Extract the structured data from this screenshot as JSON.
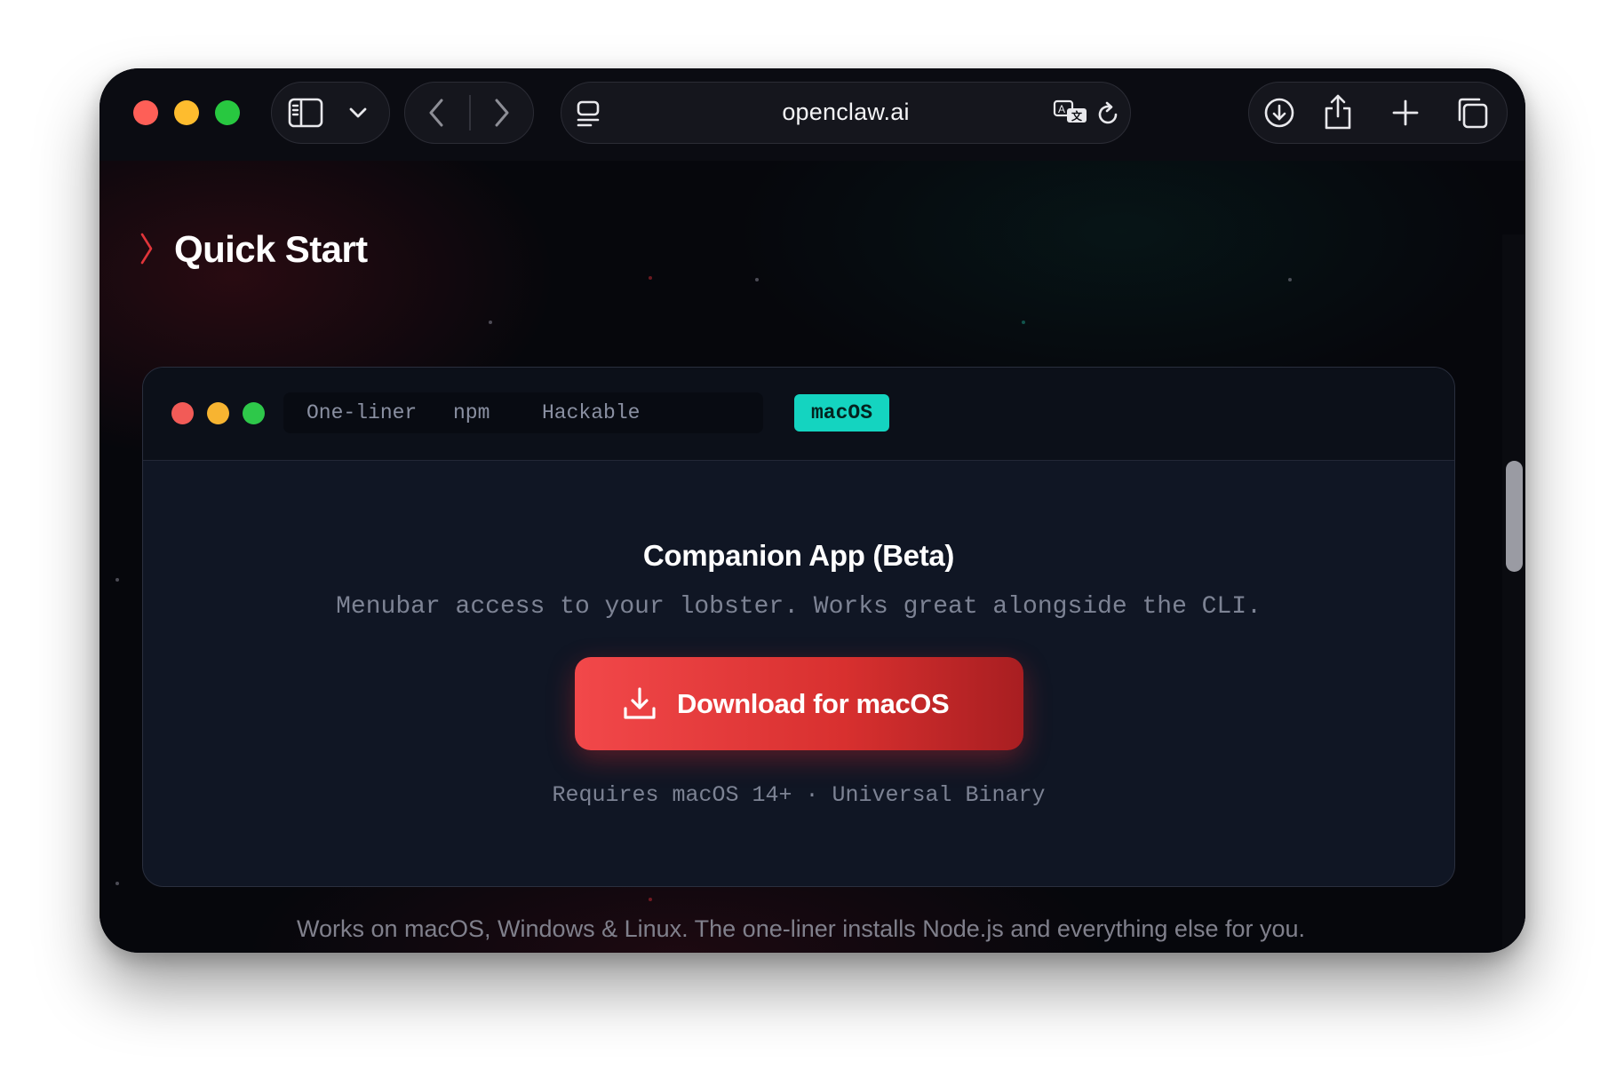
{
  "browser": {
    "url": "openclaw.ai",
    "icons": {
      "sidebar": "sidebar-icon",
      "sidebar_menu": "chevron-down-icon",
      "back": "chevron-left-icon",
      "forward": "chevron-right-icon",
      "reader": "reader-icon",
      "translate": "translate-icon",
      "reload": "reload-icon",
      "downloads": "download-circle-icon",
      "share": "share-icon",
      "new_tab": "plus-icon",
      "tabs_overview": "tabs-icon"
    }
  },
  "page": {
    "section_title": "Quick Start",
    "tabs": [
      {
        "label": "One-liner",
        "active": false
      },
      {
        "label": "npm",
        "active": false
      },
      {
        "label": "Hackable",
        "active": false
      },
      {
        "label": "macOS",
        "active": true
      }
    ],
    "panel": {
      "title": "Companion App (Beta)",
      "subtitle": "Menubar access to your lobster. Works great alongside the CLI.",
      "button_label": "Download for macOS",
      "requirements": "Requires macOS 14+ · Universal Binary"
    },
    "footer_note": "Works on macOS, Windows & Linux. The one-liner installs Node.js and everything else for you."
  },
  "colors": {
    "accent_teal": "#14d4c0",
    "button_red": "#e23a3c",
    "background": "#06070c"
  }
}
